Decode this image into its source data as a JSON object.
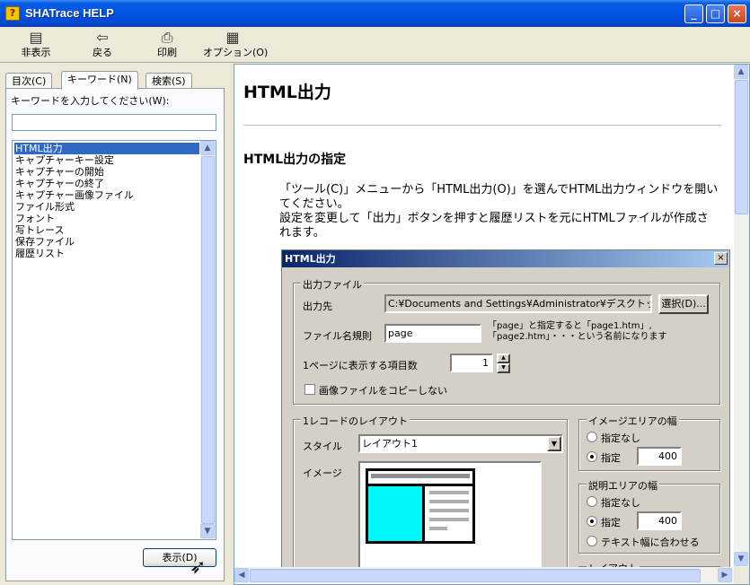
{
  "window": {
    "title": "SHATrace HELP",
    "icon": "help-icon",
    "buttons": [
      "_",
      "□",
      "×"
    ]
  },
  "toolbar": {
    "items": [
      {
        "label": "非表示",
        "icon": "hide-icon"
      },
      {
        "label": "戻る",
        "icon": "back-arrow-icon"
      },
      {
        "label": "印刷",
        "icon": "printer-icon"
      },
      {
        "label": "オプション(O)",
        "icon": "options-icon"
      }
    ]
  },
  "nav": {
    "tabs": [
      "目次(C)",
      "キーワード(N)",
      "検索(S)"
    ],
    "active_tab": "キーワード(N)",
    "keyword_prompt": "キーワードを入力してください(W):",
    "keyword_value": "",
    "items": [
      "HTML出力",
      "キャプチャーキー設定",
      "キャプチャーの開始",
      "キャプチャーの終了",
      "キャプチャー画像ファイル",
      "ファイル形式",
      "フォント",
      "写トレース",
      "保存ファイル",
      "履歴リスト"
    ],
    "selected_item": "HTML出力",
    "display_button": "表示(D)"
  },
  "content": {
    "heading": "HTML出力",
    "subheading": "HTML出力の指定",
    "paragraph_1": "「ツール(C)」メニューから「HTML出力(O)」を選んでHTML出力ウィンドウを開いてください。",
    "paragraph_2": "設定を変更して「出力」ボタンを押すと履歴リストを元にHTMLファイルが作成されます。"
  },
  "dialog": {
    "title": "HTML出力",
    "close": "×",
    "output_group": "出力ファイル",
    "dest_label": "出力先",
    "dest_value": "C:¥Documents and Settings¥Administrator¥デスクトップ¥",
    "select_button": "選択(D)...",
    "filename_label": "ファイル名規則",
    "filename_value": "page",
    "filename_hint": "「page」と指定すると「page1.htm」,「page2.htm」・・・という名前になります",
    "items_label": "1ページに表示する項目数",
    "items_value": "1",
    "nocopy_label": "画像ファイルをコピーしない",
    "layout_group": "1レコードのレイアウト",
    "style_label": "スタイル",
    "style_value": "レイアウト1",
    "image_label": "イメージ",
    "image_area_group": "イメージエリアの幅",
    "image_area_opts": [
      "指定なし",
      "指定"
    ],
    "image_area_value": "400",
    "desc_area_group": "説明エリアの幅",
    "desc_area_opts": [
      "指定なし",
      "指定",
      "テキスト幅に合わせる"
    ],
    "desc_area_value": "400",
    "next_group_partial": "レイアウト"
  }
}
